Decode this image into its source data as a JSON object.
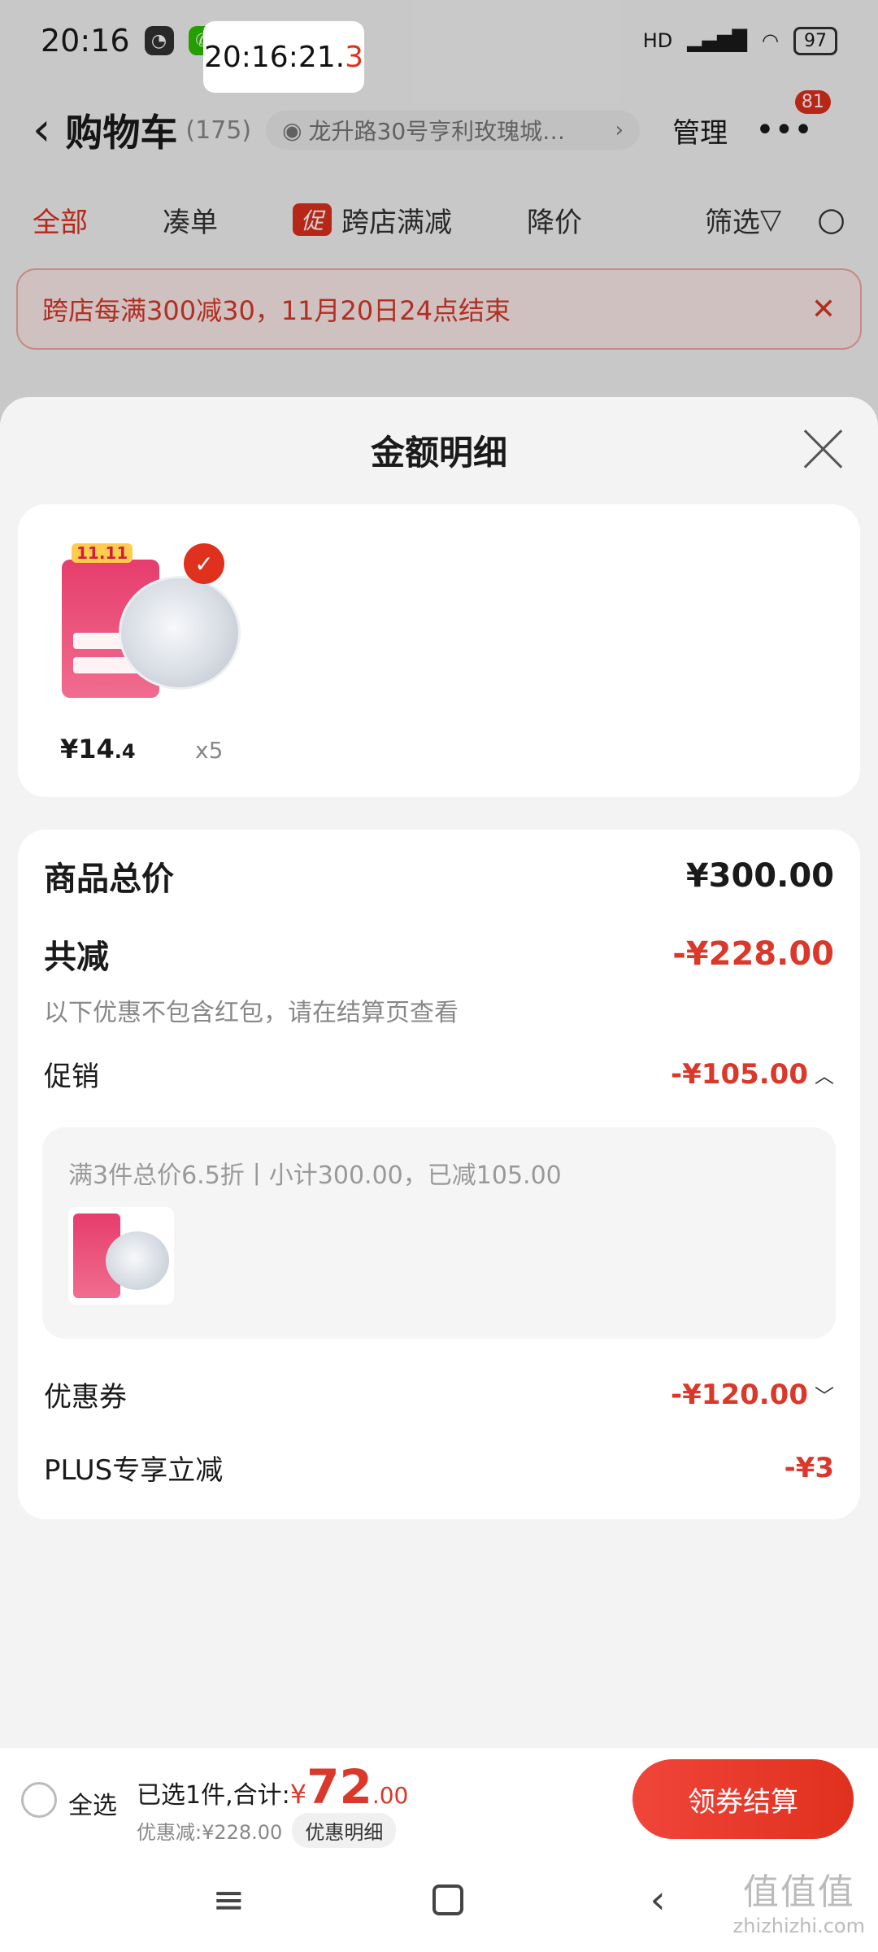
{
  "status_bar": {
    "time": "20:16",
    "timer_main": "20:16:21.",
    "timer_last": "3",
    "network": "HD",
    "battery": "97"
  },
  "header": {
    "back_icon": "chevron-left-icon",
    "title": "购物车",
    "count": "(175)",
    "address": "龙升路30号亨利玫瑰城…",
    "manage": "管理",
    "more_badge": "81"
  },
  "filters": {
    "all": "全部",
    "combine": "凑单",
    "promo_tag": "促",
    "cross_store": "跨店满减",
    "price_drop": "降价",
    "sift": "筛选"
  },
  "banner": {
    "text": "跨店每满300减30，11月20日24点结束",
    "close": "✕"
  },
  "sheet": {
    "title": "金额明细",
    "product": {
      "badge": "11.11",
      "price_int": "¥14",
      "price_dec": ".4",
      "qty": "x5"
    },
    "total_label": "商品总价",
    "total_value": "¥300.00",
    "reduce_label": "共减",
    "reduce_value": "-¥228.00",
    "note": "以下优惠不包含红包，请在结算页查看",
    "promo_label": "促销",
    "promo_value": "-¥105.00",
    "promo_desc": "满3件总价6.5折丨小计300.00，已减105.00",
    "coupon_label": "优惠券",
    "coupon_value": "-¥120.00",
    "plus_label": "PLUS专享立减",
    "plus_value": "-¥3"
  },
  "checkout": {
    "select_all": "全选",
    "selected_text": "已选1件,合计:",
    "yen": "¥",
    "amount_int": "72",
    "amount_dec": ".00",
    "discount_text": "优惠减:¥228.00",
    "detail_chip": "优惠明细",
    "button": "领券结算"
  },
  "watermark": {
    "big": "值值值",
    "small": "zhizhizhi.com"
  },
  "colors": {
    "accent": "#e0301e",
    "price_red": "#d9382a"
  }
}
